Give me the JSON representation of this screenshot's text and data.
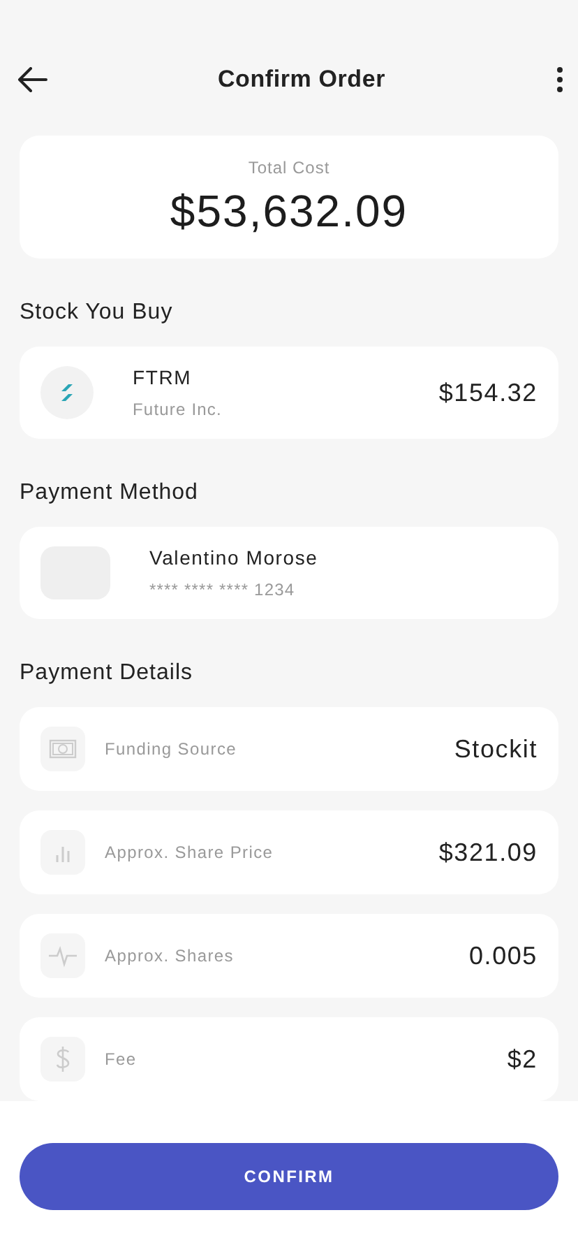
{
  "header": {
    "title": "Confirm Order"
  },
  "total": {
    "label": "Total Cost",
    "amount": "$53,632.09"
  },
  "stock_section": {
    "title": "Stock You Buy"
  },
  "stock": {
    "ticker": "FTRM",
    "company": "Future Inc.",
    "price": "$154.32"
  },
  "payment_section": {
    "title": "Payment Method"
  },
  "payment": {
    "name": "Valentino Morose",
    "card": "**** **** **** 1234"
  },
  "details_section": {
    "title": "Payment Details"
  },
  "details": [
    {
      "kind": "money",
      "label": "Funding Source",
      "value": "Stockit"
    },
    {
      "kind": "bars",
      "label": "Approx. Share Price",
      "value": "$321.09"
    },
    {
      "kind": "pulse",
      "label": "Approx. Shares",
      "value": "0.005"
    },
    {
      "kind": "dollar",
      "label": "Fee",
      "value": "$2"
    }
  ],
  "confirm_button": "CONFIRM"
}
